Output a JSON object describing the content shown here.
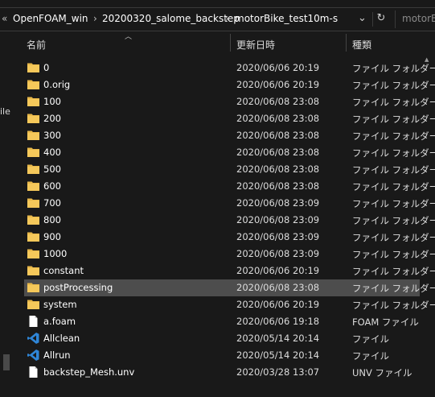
{
  "address": {
    "crumbs": [
      "OpenFOAM_win",
      "20200320_salome_backstep",
      "motorBike_test10m-s"
    ],
    "search_placeholder": "motorBik"
  },
  "navpane": {
    "fragment": "ile"
  },
  "columns": {
    "name": "名前",
    "date": "更新日時",
    "type": "種類"
  },
  "colors": {
    "background": "#191919",
    "selected_row": "#4d4d4d",
    "folder": "#e8b84a",
    "vscode": "#2f86d8"
  },
  "files": [
    {
      "name": "0",
      "date": "2020/06/06 20:19",
      "type": "ファイル フォルダー",
      "icon": "folder-icon"
    },
    {
      "name": "0.orig",
      "date": "2020/06/06 20:19",
      "type": "ファイル フォルダー",
      "icon": "folder-icon"
    },
    {
      "name": "100",
      "date": "2020/06/08 23:08",
      "type": "ファイル フォルダー",
      "icon": "folder-icon"
    },
    {
      "name": "200",
      "date": "2020/06/08 23:08",
      "type": "ファイル フォルダー",
      "icon": "folder-icon"
    },
    {
      "name": "300",
      "date": "2020/06/08 23:08",
      "type": "ファイル フォルダー",
      "icon": "folder-icon"
    },
    {
      "name": "400",
      "date": "2020/06/08 23:08",
      "type": "ファイル フォルダー",
      "icon": "folder-icon"
    },
    {
      "name": "500",
      "date": "2020/06/08 23:08",
      "type": "ファイル フォルダー",
      "icon": "folder-icon"
    },
    {
      "name": "600",
      "date": "2020/06/08 23:08",
      "type": "ファイル フォルダー",
      "icon": "folder-icon"
    },
    {
      "name": "700",
      "date": "2020/06/08 23:09",
      "type": "ファイル フォルダー",
      "icon": "folder-icon"
    },
    {
      "name": "800",
      "date": "2020/06/08 23:09",
      "type": "ファイル フォルダー",
      "icon": "folder-icon"
    },
    {
      "name": "900",
      "date": "2020/06/08 23:09",
      "type": "ファイル フォルダー",
      "icon": "folder-icon"
    },
    {
      "name": "1000",
      "date": "2020/06/08 23:09",
      "type": "ファイル フォルダー",
      "icon": "folder-icon"
    },
    {
      "name": "constant",
      "date": "2020/06/06 20:19",
      "type": "ファイル フォルダー",
      "icon": "folder-icon"
    },
    {
      "name": "postProcessing",
      "date": "2020/06/08 23:08",
      "type": "ファイル フォルダー",
      "icon": "folder-icon"
    },
    {
      "name": "system",
      "date": "2020/06/06 20:19",
      "type": "ファイル フォルダー",
      "icon": "folder-icon"
    },
    {
      "name": "a.foam",
      "date": "2020/06/06 19:18",
      "type": "FOAM ファイル",
      "icon": "file-icon"
    },
    {
      "name": "Allclean",
      "date": "2020/05/14 20:14",
      "type": "ファイル",
      "icon": "vscode-icon"
    },
    {
      "name": "Allrun",
      "date": "2020/05/14 20:14",
      "type": "ファイル",
      "icon": "vscode-icon"
    },
    {
      "name": "backstep_Mesh.unv",
      "date": "2020/03/28 13:07",
      "type": "UNV ファイル",
      "icon": "file-icon"
    }
  ],
  "selected_file": "postProcessing"
}
